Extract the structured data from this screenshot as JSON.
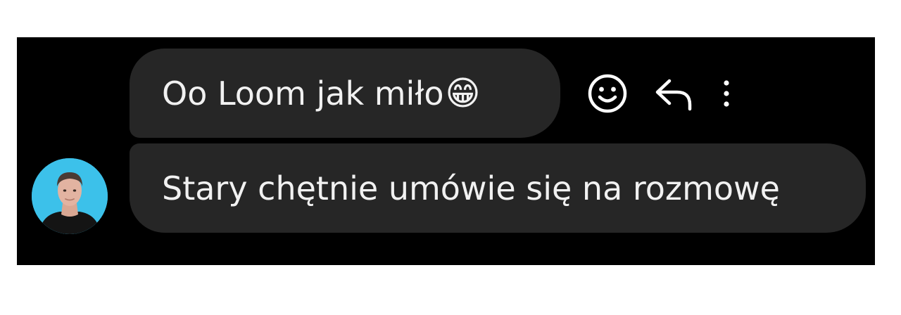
{
  "messages": [
    {
      "text": "Oo Loom jak miło",
      "emoji": "😁",
      "emoji_name": "grinning-face-with-smiling-eyes"
    },
    {
      "text": "Stary chętnie umówie się na rozmowę"
    }
  ],
  "actions": [
    {
      "icon": "smiley-icon",
      "label": "React"
    },
    {
      "icon": "reply-arrow-icon",
      "label": "Reply"
    },
    {
      "icon": "vertical-dots-icon",
      "label": "More"
    }
  ],
  "colors": {
    "background": "#000000",
    "bubble": "#262626",
    "text": "#f1f1f1",
    "icon": "#ffffff",
    "avatar_bg": "#3cc1ea"
  }
}
